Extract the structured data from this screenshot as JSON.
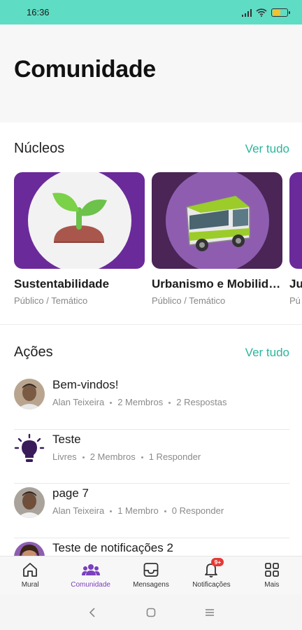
{
  "status_bar": {
    "time": "16:36",
    "battery_level": 0.55,
    "battery_color": "#f1c232"
  },
  "page": {
    "title": "Comunidade"
  },
  "nucleos": {
    "title": "Núcleos",
    "see_all": "Ver tudo",
    "cards": [
      {
        "name": "Sustentabilidade",
        "subtitle": "Público / Temático",
        "image_icon": "sprout-icon"
      },
      {
        "name": "Urbanismo e Mobilidade",
        "subtitle": "Público / Temático",
        "image_icon": "bus-icon"
      },
      {
        "name": "Ju",
        "subtitle": "Pú",
        "image_icon": "group-image"
      }
    ]
  },
  "acoes": {
    "title": "Ações",
    "see_all": "Ver tudo",
    "items": [
      {
        "title": "Bem-vindos!",
        "meta": [
          "Alan Teixeira",
          "2 Membros",
          "2 Respostas"
        ],
        "icon": "user-avatar"
      },
      {
        "title": "Teste",
        "meta": [
          "Livres",
          "2 Membros",
          "1 Responder"
        ],
        "icon": "lightbulb-icon"
      },
      {
        "title": "page 7",
        "meta": [
          "Alan Teixeira",
          "1 Membro",
          "0 Responder"
        ],
        "icon": "user-avatar"
      },
      {
        "title": "Teste de notificações 2",
        "meta": [],
        "icon": "user-avatar"
      }
    ]
  },
  "bottom_nav": {
    "items": [
      {
        "label": "Mural",
        "icon": "home-icon",
        "active": false
      },
      {
        "label": "Comunidade",
        "icon": "people-icon",
        "active": true
      },
      {
        "label": "Mensagens",
        "icon": "inbox-icon",
        "active": false
      },
      {
        "label": "Notificações",
        "icon": "bell-icon",
        "active": false,
        "badge": "9+"
      },
      {
        "label": "Mais",
        "icon": "grid-icon",
        "active": false
      }
    ]
  },
  "colors": {
    "accent": "#2bb59b",
    "brand_purple": "#7b3fbf",
    "status_bar": "#5fdcc4",
    "badge": "#e53935"
  }
}
